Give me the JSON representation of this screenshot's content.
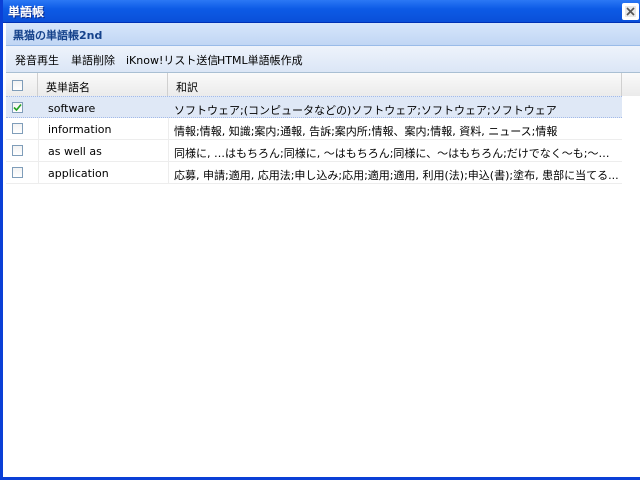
{
  "window": {
    "title": "単語帳",
    "close_icon": "close-icon"
  },
  "header": {
    "title": "黒猫の単語帳2nd"
  },
  "toolbar": {
    "items": [
      "発音再生",
      "単語削除",
      "iKnow!リスト送信",
      "HTML単語帳作成"
    ]
  },
  "grid": {
    "columns": [
      "英単語名",
      "和訳"
    ],
    "rows": [
      {
        "checked": true,
        "en": "software",
        "ja": "ソフトウェア;(コンピュータなどの)ソフトウェア;ソフトウェア;ソフトウェア"
      },
      {
        "checked": false,
        "en": "information",
        "ja": "情報;情報, 知識;案内;通報, 告訴;案内所;情報、案内;情報, 資料, ニュース;情報"
      },
      {
        "checked": false,
        "en": "as well as",
        "ja": "同様に, …はもちろん;同様に, ～はもちろん;同様に、～はもちろん;だけでなく～も;～と同様に..."
      },
      {
        "checked": false,
        "en": "application",
        "ja": "応募, 申請;適用, 応用法;申し込み;応用;適用;適用, 利用(法);申込(書);塗布, 患部に当てる..."
      }
    ]
  },
  "colors": {
    "titlebar": "#0a4fd9",
    "header_text": "#15428b",
    "selected_row": "#dfe8f6"
  }
}
